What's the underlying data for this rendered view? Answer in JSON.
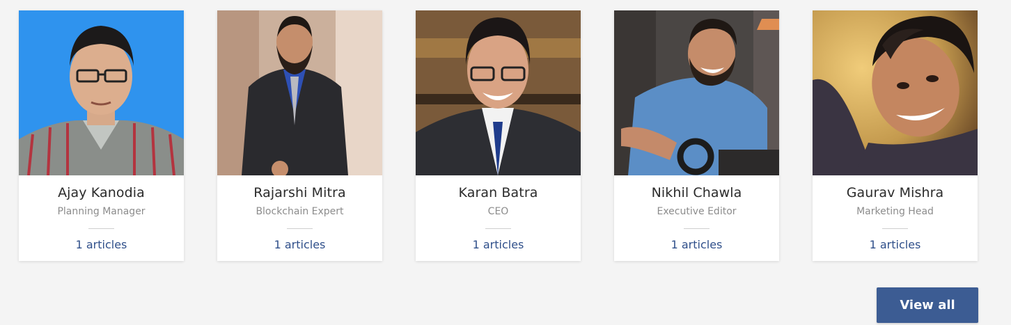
{
  "authors": [
    {
      "name": "Ajay Kanodia",
      "role": "Planning Manager",
      "articles": "1 articles",
      "photo": "person-portrait",
      "bg": "#2f93ee"
    },
    {
      "name": "Rajarshi Mitra",
      "role": "Blockchain Expert",
      "articles": "1 articles",
      "photo": "person-portrait",
      "bg": "#d9c2b0"
    },
    {
      "name": "Karan Batra",
      "role": "CEO",
      "articles": "1 articles",
      "photo": "person-portrait",
      "bg": "#7a5a3a"
    },
    {
      "name": "Nikhil Chawla",
      "role": "Executive Editor",
      "articles": "1 articles",
      "photo": "person-portrait",
      "bg": "#4a4644"
    },
    {
      "name": "Gaurav Mishra",
      "role": "Marketing Head",
      "articles": "1 articles",
      "photo": "person-portrait",
      "bg": "#c49a4e"
    }
  ],
  "view_all_label": "View all",
  "colors": {
    "page_bg": "#f4f4f4",
    "accent": "#3c5c93",
    "link": "#2f4f8a"
  }
}
